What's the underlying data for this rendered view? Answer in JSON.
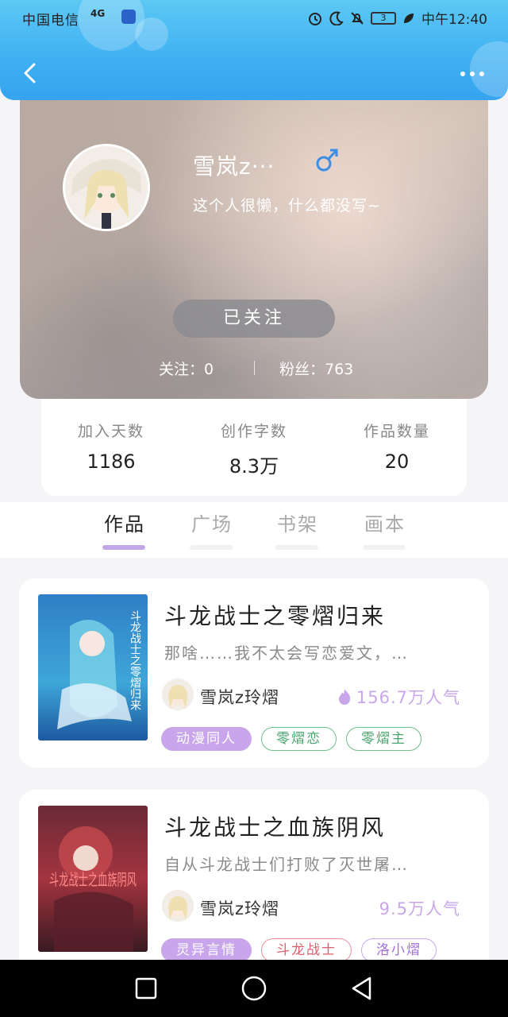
{
  "status_bar": {
    "carrier": "中国电信",
    "signal": "4G",
    "battery": "3",
    "time": "中午12:40"
  },
  "header": {
    "back_icon": "chevron-left-icon",
    "more_icon": "more-dots-icon"
  },
  "profile": {
    "username": "雪岚z···",
    "gender_icon": "male-icon",
    "bio": "这个人很懒，什么都没写~",
    "follow_button": "已关注",
    "following_text": "关注：0",
    "followers_text": "粉丝：763"
  },
  "stats": [
    {
      "label": "加入天数",
      "value": "1186"
    },
    {
      "label": "创作字数",
      "value": "8.3万"
    },
    {
      "label": "作品数量",
      "value": "20"
    }
  ],
  "tabs": [
    {
      "label": "作品",
      "active": true
    },
    {
      "label": "广场",
      "active": false
    },
    {
      "label": "书架",
      "active": false
    },
    {
      "label": "画本",
      "active": false
    }
  ],
  "books": [
    {
      "title": "斗龙战士之零熠归来",
      "description": "那啥……我不太会写恋爱文，…",
      "author": "雪岚z玲熠",
      "popularity": "156.7万人气",
      "show_fire": true,
      "cover_text": "斗龙战士之零熠归来",
      "tags": [
        {
          "label": "动漫同人",
          "style": "fill"
        },
        {
          "label": "零熠恋",
          "style": "green"
        },
        {
          "label": "零熠主",
          "style": "green"
        }
      ]
    },
    {
      "title": "斗龙战士之血族阴风",
      "description": "自从斗龙战士们打败了灭世屠…",
      "author": "雪岚z玲熠",
      "popularity": "9.5万人气",
      "show_fire": false,
      "cover_text": "斗龙战士之血族阴风",
      "tags": [
        {
          "label": "灵异言情",
          "style": "fill"
        },
        {
          "label": "斗龙战士",
          "style": "red"
        },
        {
          "label": "洛小熠",
          "style": "purple"
        }
      ]
    }
  ],
  "colors": {
    "header_blue": "#3fb0f2",
    "accent_purple": "#c9a6ec",
    "tag_green": "#6cbf8a",
    "tag_red": "#e9909a"
  }
}
